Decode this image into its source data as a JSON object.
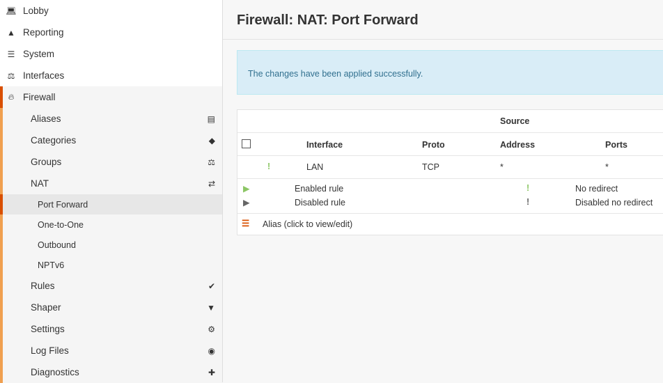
{
  "sidebar": {
    "top": [
      {
        "label": "Lobby",
        "icon": "laptop-icon"
      },
      {
        "label": "Reporting",
        "icon": "area-chart-icon"
      },
      {
        "label": "System",
        "icon": "server-icon"
      },
      {
        "label": "Interfaces",
        "icon": "sitemap-icon"
      }
    ],
    "firewall": {
      "label": "Firewall",
      "icon": "fire-icon"
    },
    "firewall_items": [
      {
        "label": "Aliases",
        "icon": "list-alt-icon"
      },
      {
        "label": "Categories",
        "icon": "tags-icon"
      },
      {
        "label": "Groups",
        "icon": "sitemap-icon"
      },
      {
        "label": "NAT",
        "icon": "exchange-icon"
      }
    ],
    "nat_items": [
      "Port Forward",
      "One-to-One",
      "Outbound",
      "NPTv6"
    ],
    "firewall_items2": [
      {
        "label": "Rules",
        "icon": "check-icon"
      },
      {
        "label": "Shaper",
        "icon": "filter-icon"
      },
      {
        "label": "Settings",
        "icon": "cogs-icon"
      },
      {
        "label": "Log Files",
        "icon": "eye-icon"
      },
      {
        "label": "Diagnostics",
        "icon": "medkit-icon"
      }
    ]
  },
  "header": {
    "title": "Firewall: NAT: Port Forward"
  },
  "alert": {
    "text": "The changes have been applied successfully."
  },
  "table": {
    "group_header": "Source",
    "headers": {
      "interface": "Interface",
      "proto": "Proto",
      "address": "Address",
      "ports": "Ports"
    },
    "rows": [
      {
        "interface": "LAN",
        "proto": "TCP",
        "address": "*",
        "ports": "*"
      }
    ],
    "legend": {
      "enabled": "Enabled rule",
      "disabled": "Disabled rule",
      "no_redirect": "No redirect",
      "disabled_no_redirect": "Disabled no redirect",
      "alias": "Alias (click to view/edit)"
    }
  },
  "colors": {
    "accent": "#d94f00",
    "accent_light": "#f0a050",
    "green": "#8cc665"
  }
}
